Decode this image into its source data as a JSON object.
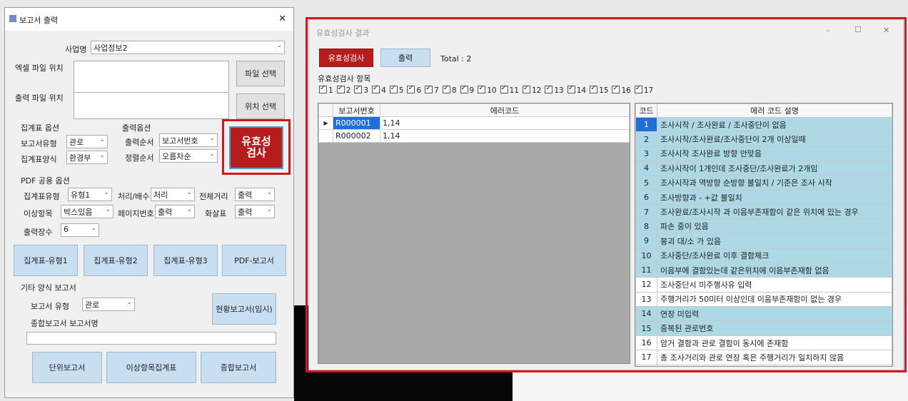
{
  "report_dialog": {
    "title": "보고서 출력",
    "close_glyph": "✕",
    "business_name": {
      "label": "사업명",
      "value": "사업정보2"
    },
    "excel_file": {
      "label": "엑셀 파일 위치",
      "button": "파일 선택"
    },
    "output_file": {
      "label": "출력 파일 위치",
      "button": "위치 선택"
    },
    "summary_options": {
      "title": "집계표 옵션",
      "report_type": {
        "label": "보고서유형",
        "value": "관로"
      },
      "summary_format": {
        "label": "집계표양식",
        "value": "환경부"
      }
    },
    "output_options": {
      "title": "출력옵션",
      "output_order": {
        "label": "출력순서",
        "value": "보고서번호"
      },
      "sort_order": {
        "label": "정렬순서",
        "value": "오름차순"
      }
    },
    "validate_button": "유효성\n검사",
    "pdf_options": {
      "title": "PDF 공용 옵션",
      "summary_type": {
        "label": "집계표유형",
        "value": "유형1"
      },
      "process_count": {
        "label": "처리/배수",
        "value": "처리"
      },
      "total_distance": {
        "label": "전체거리",
        "value": "출력"
      },
      "abnormal_items": {
        "label": "이상항목",
        "value": "박스있음"
      },
      "page_number": {
        "label": "페이지번호",
        "value": "출력"
      },
      "arrow": {
        "label": "화살표",
        "value": "출력"
      },
      "output_count": {
        "label": "출력장수",
        "value": "6"
      }
    },
    "buttons_row1": [
      "집계표-유형1",
      "집계표-유형2",
      "집계표-유형3",
      "PDF-보고서"
    ],
    "other_format": {
      "title": "기타 양식 보고서",
      "report_type": {
        "label": "보고서 유형",
        "value": "관로"
      },
      "field_report_button": "현황보고서(임시)",
      "combined_name_label": "종합보고서 보고서명",
      "combined_name_value": ""
    },
    "buttons_row2": [
      "단위보고서",
      "이상항목집계표",
      "종합보고서"
    ]
  },
  "validation_window": {
    "title": "유효성검사 결과",
    "window_controls": [
      "–",
      "☐",
      "✕"
    ],
    "buttons": {
      "validate": "유효성검사",
      "output": "출력"
    },
    "total_text": "Total : 2",
    "items_label": "유효성검사 항목",
    "check_items": [
      "1",
      "2",
      "3",
      "4",
      "5",
      "6",
      "7",
      "8",
      "9",
      "10",
      "11",
      "12",
      "13",
      "14",
      "15",
      "16",
      "17"
    ],
    "result_table": {
      "columns": [
        "보고서번호",
        "에러코드"
      ],
      "rows": [
        {
          "report_no": "R000001",
          "error_code": "1,14"
        },
        {
          "report_no": "R000002",
          "error_code": "1,14"
        }
      ]
    },
    "code_table": {
      "columns": [
        "코드",
        "에러 코드 설명"
      ],
      "rows": [
        {
          "code": "1",
          "desc": "조사시작 / 조사완료 / 조사중단이 없음",
          "hl": true
        },
        {
          "code": "2",
          "desc": "조사시작/조사완료/조사중단이 2개 이상일때",
          "hl": true
        },
        {
          "code": "3",
          "desc": "조사시작 조사완료 방향 안맞음",
          "hl": true
        },
        {
          "code": "4",
          "desc": "조사시작이 1개인데 조사중단/조사완료가 2개임",
          "hl": true
        },
        {
          "code": "5",
          "desc": "조사시작과 역방향 순방향 불일치 / 기준은 조사 시작",
          "hl": true
        },
        {
          "code": "6",
          "desc": "조사방향과 - +값 불일치",
          "hl": true
        },
        {
          "code": "7",
          "desc": "조사완료/조사시작 과 이음부존재함이 같은 위치에 있는 경우",
          "hl": true
        },
        {
          "code": "8",
          "desc": "파손 중이 있음",
          "hl": true
        },
        {
          "code": "9",
          "desc": "붕괴 대/소 가 있음",
          "hl": true
        },
        {
          "code": "10",
          "desc": "조사중단/조사완료 이후 결함체크",
          "hl": true
        },
        {
          "code": "11",
          "desc": "이음부에 결함있는데 같은위치에 이음부존재함 없음",
          "hl": true
        },
        {
          "code": "12",
          "desc": "조사중단시 미주행사유 입력",
          "hl": false
        },
        {
          "code": "13",
          "desc": "주행거리가 50미터 이상인데 이음부존재함이 없는 경우",
          "hl": false
        },
        {
          "code": "14",
          "desc": "연장 미입력",
          "hl": true
        },
        {
          "code": "15",
          "desc": "중복된 관로번호",
          "hl": true
        },
        {
          "code": "16",
          "desc": "암거 결함과 관로 결함이 동시에 존재함",
          "hl": false
        },
        {
          "code": "17",
          "desc": "총 조사거리와 관로 연장 혹은 주행거리가 일치하지 않음",
          "hl": false
        }
      ]
    }
  },
  "colors": {
    "validate_red": "#b71c1c",
    "highlight_blue": "#add8e6",
    "frame_red": "#d0191a",
    "btn_blue": "#c8dff2"
  }
}
